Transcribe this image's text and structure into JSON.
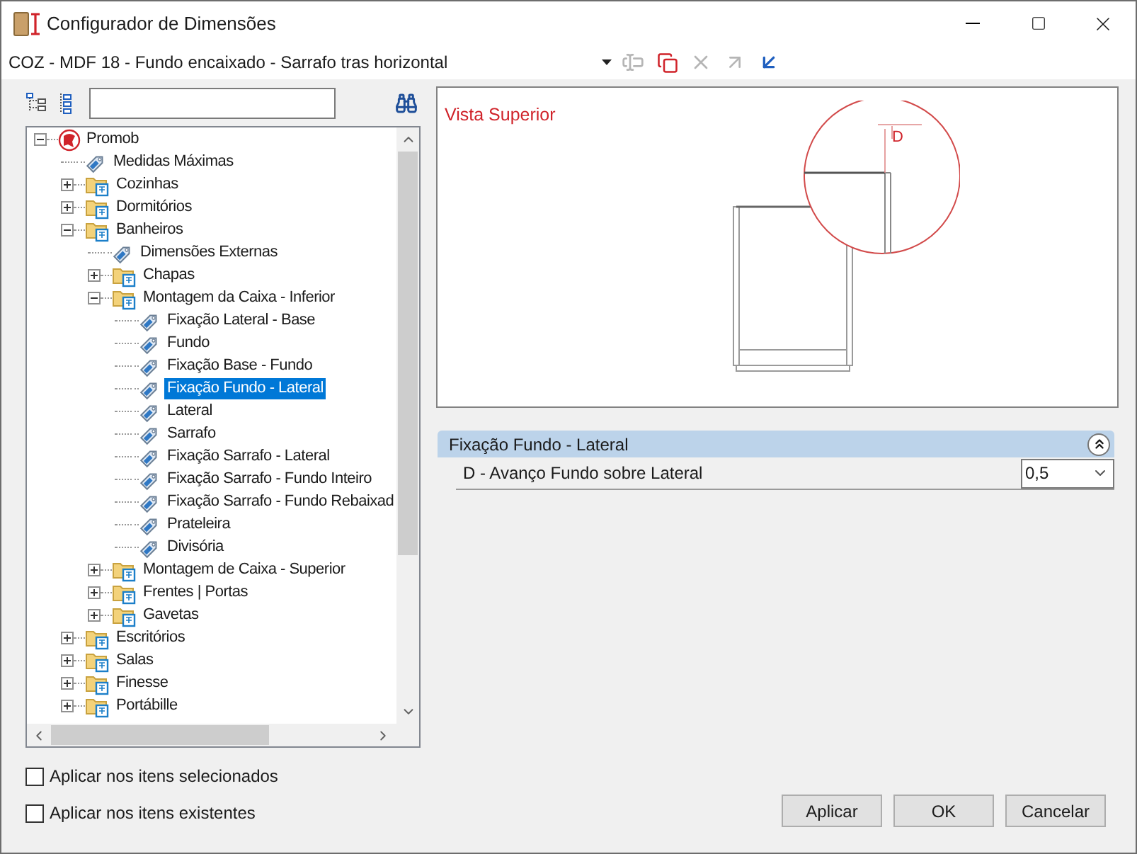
{
  "window": {
    "title": "Configurador de Dimensões"
  },
  "toolbar": {
    "combo_value": "COZ - MDF 18 - Fundo encaixado - Sarrafo tras horizontal",
    "buttons": [
      {
        "kind": "rename",
        "disabled": true
      },
      {
        "kind": "copy",
        "disabled": false
      },
      {
        "kind": "delete",
        "disabled": true
      },
      {
        "kind": "import",
        "disabled": true
      },
      {
        "kind": "export",
        "disabled": false
      }
    ]
  },
  "tree": {
    "items": [
      {
        "label": "Promob",
        "kind": "root",
        "expanded": true,
        "selected": false,
        "children": [
          {
            "label": "Medidas Máximas",
            "kind": "leaf",
            "selected": false
          },
          {
            "label": "Cozinhas",
            "kind": "folder",
            "expanded": false,
            "selected": false
          },
          {
            "label": "Dormitórios",
            "kind": "folder",
            "expanded": false,
            "selected": false
          },
          {
            "label": "Banheiros",
            "kind": "folder",
            "expanded": true,
            "selected": false,
            "children": [
              {
                "label": "Dimensões Externas",
                "kind": "leaf",
                "selected": false
              },
              {
                "label": "Chapas",
                "kind": "folder",
                "expanded": false,
                "selected": false
              },
              {
                "label": "Montagem da Caixa - Inferior",
                "kind": "folder",
                "expanded": true,
                "selected": false,
                "children": [
                  {
                    "label": "Fixação Lateral - Base",
                    "kind": "leaf",
                    "selected": false
                  },
                  {
                    "label": "Fundo",
                    "kind": "leaf",
                    "selected": false
                  },
                  {
                    "label": "Fixação Base - Fundo",
                    "kind": "leaf",
                    "selected": false
                  },
                  {
                    "label": "Fixação Fundo - Lateral",
                    "kind": "leaf",
                    "selected": true
                  },
                  {
                    "label": "Lateral",
                    "kind": "leaf",
                    "selected": false
                  },
                  {
                    "label": "Sarrafo",
                    "kind": "leaf",
                    "selected": false
                  },
                  {
                    "label": "Fixação Sarrafo - Lateral",
                    "kind": "leaf",
                    "selected": false
                  },
                  {
                    "label": "Fixação Sarrafo - Fundo Inteiro",
                    "kind": "leaf",
                    "selected": false
                  },
                  {
                    "label": "Fixação Sarrafo - Fundo Rebaixad",
                    "kind": "leaf",
                    "selected": false
                  },
                  {
                    "label": "Prateleira",
                    "kind": "leaf",
                    "selected": false
                  },
                  {
                    "label": "Divisória",
                    "kind": "leaf",
                    "selected": false
                  }
                ]
              },
              {
                "label": "Montagem de Caixa - Superior",
                "kind": "folder",
                "expanded": false,
                "selected": false
              },
              {
                "label": "Frentes | Portas",
                "kind": "folder",
                "expanded": false,
                "selected": false
              },
              {
                "label": "Gavetas",
                "kind": "folder",
                "expanded": false,
                "selected": false
              }
            ]
          },
          {
            "label": "Escritórios",
            "kind": "folder",
            "expanded": false,
            "selected": false
          },
          {
            "label": "Salas",
            "kind": "folder",
            "expanded": false,
            "selected": false
          },
          {
            "label": "Finesse",
            "kind": "folder",
            "expanded": false,
            "selected": false
          },
          {
            "label": "Portábille",
            "kind": "folder",
            "expanded": false,
            "selected": false
          }
        ]
      }
    ]
  },
  "preview": {
    "title": "Vista Superior",
    "dimension_label": "D"
  },
  "properties": {
    "group": {
      "title": "Fixação Fundo - Lateral",
      "expanded": true
    },
    "rows": [
      {
        "label": "D - Avanço Fundo sobre Lateral",
        "value": "0,5"
      }
    ]
  },
  "options": [
    {
      "label": "Aplicar nos itens selecionados",
      "checked": false
    },
    {
      "label": "Aplicar nos itens existentes",
      "checked": false
    }
  ],
  "buttons": [
    "Aplicar",
    "OK",
    "Cancelar"
  ]
}
